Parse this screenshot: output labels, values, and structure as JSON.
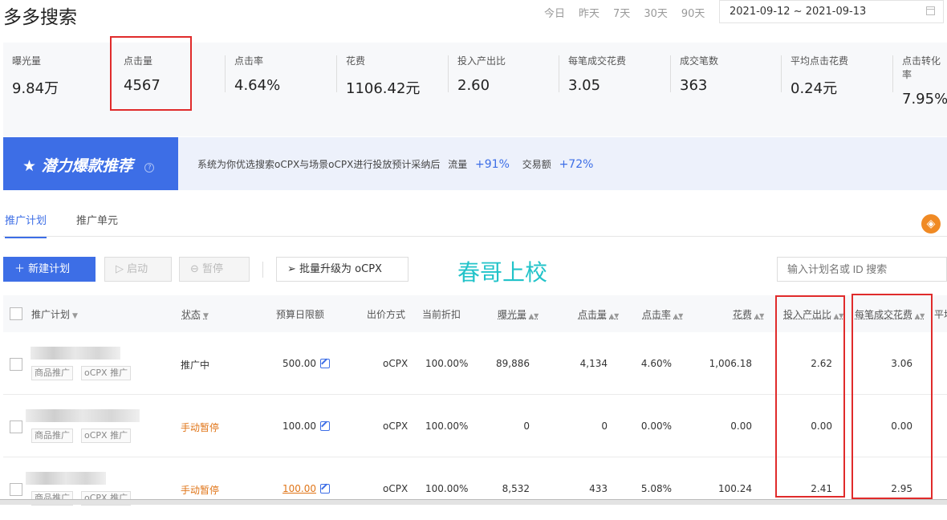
{
  "header": {
    "title": "多多搜索",
    "range_tabs": [
      "今日",
      "昨天",
      "7天",
      "30天",
      "90天"
    ],
    "date_range": "2021-09-12 ~ 2021-09-13"
  },
  "metrics": [
    {
      "label": "曝光量",
      "value": "9.84万"
    },
    {
      "label": "点击量",
      "value": "4567"
    },
    {
      "label": "点击率",
      "value": "4.64%"
    },
    {
      "label": "花费",
      "value": "1106.42元"
    },
    {
      "label": "投入产出比",
      "value": "2.60"
    },
    {
      "label": "每笔成交花费",
      "value": "3.05"
    },
    {
      "label": "成交笔数",
      "value": "363"
    },
    {
      "label": "平均点击花费",
      "value": "0.24元"
    },
    {
      "label": "点击转化率",
      "value": "7.95%"
    }
  ],
  "promo": {
    "title": "潜力爆款推荐",
    "star": "★",
    "help": "?",
    "text": "系统为你优选搜索oCPX与场景oCPX进行投放预计采纳后",
    "flow_label": "流量",
    "flow_value": "+91%",
    "gmv_label": "交易额",
    "gmv_value": "+72%"
  },
  "tabs": {
    "plan": "推广计划",
    "unit": "推广单元"
  },
  "toolbar": {
    "new_plan": "新建计划",
    "start": "启动",
    "pause": "暂停",
    "upgrade": "批量升级为 oCPX",
    "watermark": "春哥上校",
    "search_placeholder": "输入计划名或 ID 搜索"
  },
  "table": {
    "columns": [
      "推广计划",
      "状态",
      "预算日限额",
      "出价方式",
      "当前折扣",
      "曝光量",
      "点击量",
      "点击率",
      "花费",
      "投入产出比",
      "每笔成交花费",
      "平均"
    ],
    "rows": [
      {
        "tags": [
          "商品推广",
          "oCPX 推广"
        ],
        "status": "推广中",
        "budget": "500.00",
        "bid": "oCPX",
        "discount": "100.00%",
        "impressions": "89,886",
        "clicks": "4,134",
        "ctr": "4.60%",
        "cost": "1,006.18",
        "roi": "2.62",
        "cpo": "3.06"
      },
      {
        "tags": [
          "商品推广",
          "oCPX 推广"
        ],
        "status": "手动暂停",
        "budget": "100.00",
        "bid": "oCPX",
        "discount": "100.00%",
        "impressions": "0",
        "clicks": "0",
        "ctr": "0.00%",
        "cost": "0.00",
        "roi": "0.00",
        "cpo": "0.00"
      },
      {
        "tags": [
          "商品推广",
          "oCPX 推广"
        ],
        "status": "手动暂停",
        "budget": "100.00",
        "bid": "oCPX",
        "discount": "100.00%",
        "impressions": "8,532",
        "clicks": "433",
        "ctr": "5.08%",
        "cost": "100.24",
        "roi": "2.41",
        "cpo": "2.95"
      }
    ]
  },
  "colors": {
    "accent": "#3d6ee6",
    "highlight_box": "#e02b2b",
    "paused": "#e07518",
    "watermark": "#22c3c9"
  }
}
